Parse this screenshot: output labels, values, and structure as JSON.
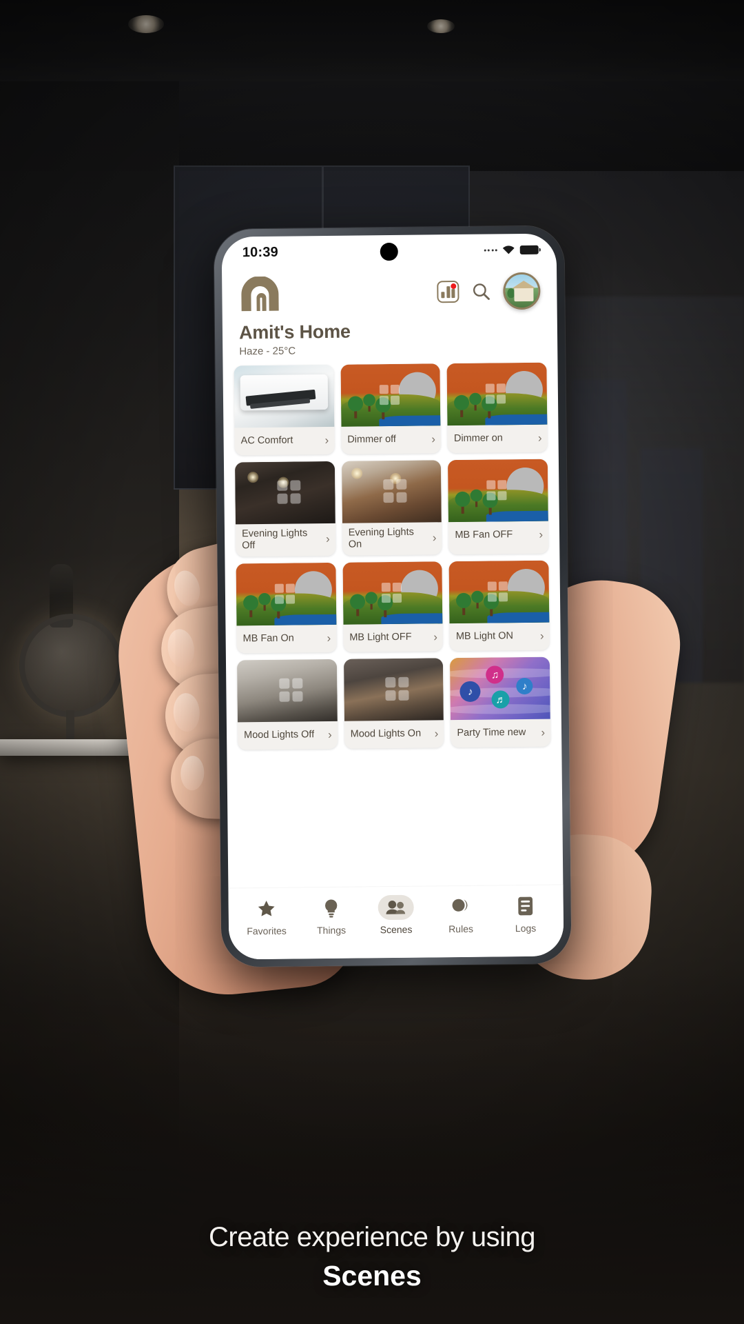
{
  "status_bar": {
    "time": "10:39",
    "icons": [
      "signal-dots-icon",
      "wifi-icon",
      "battery-icon"
    ]
  },
  "header": {
    "logo_name": "home-arch-logo",
    "home_title": "Amit's Home",
    "weather": "Haze - 25°C",
    "chart_icon": "chart-icon",
    "chart_badge": true,
    "search_icon": "search-icon",
    "avatar_name": "user-avatar"
  },
  "scenes": [
    {
      "label": "AC Comfort",
      "art": "ac",
      "chevron": "›"
    },
    {
      "label": "Dimmer off",
      "art": "landscape",
      "chevron": "›"
    },
    {
      "label": "Dimmer on",
      "art": "landscape",
      "chevron": "›"
    },
    {
      "label": "Evening Lights Off",
      "art": "room-dark",
      "chevron": "›"
    },
    {
      "label": "Evening Lights On",
      "art": "room-lit",
      "chevron": "›"
    },
    {
      "label": "MB Fan OFF",
      "art": "landscape",
      "chevron": "›"
    },
    {
      "label": "MB Fan On",
      "art": "landscape",
      "chevron": "›"
    },
    {
      "label": "MB Light OFF",
      "art": "landscape",
      "chevron": "›"
    },
    {
      "label": "MB Light ON",
      "art": "landscape",
      "chevron": "›"
    },
    {
      "label": "Mood Lights Off",
      "art": "room-grey",
      "chevron": "›"
    },
    {
      "label": "Mood Lights On",
      "art": "room-brick",
      "chevron": "›"
    },
    {
      "label": "Party Time new",
      "art": "party",
      "chevron": "›"
    }
  ],
  "tabbar": {
    "active": "Scenes",
    "items": [
      {
        "label": "Favorites",
        "icon": "star-icon"
      },
      {
        "label": "Things",
        "icon": "bulb-icon"
      },
      {
        "label": "Scenes",
        "icon": "scenes-icon"
      },
      {
        "label": "Rules",
        "icon": "rules-icon"
      },
      {
        "label": "Logs",
        "icon": "logs-icon"
      }
    ]
  },
  "marketing": {
    "line1": "Create experience by using",
    "line2": "Scenes"
  },
  "colors": {
    "brand": "#8a7a5d",
    "title": "#5d5446",
    "badge": "#ee1b1b",
    "tile_bg": "#f3f1ee"
  }
}
